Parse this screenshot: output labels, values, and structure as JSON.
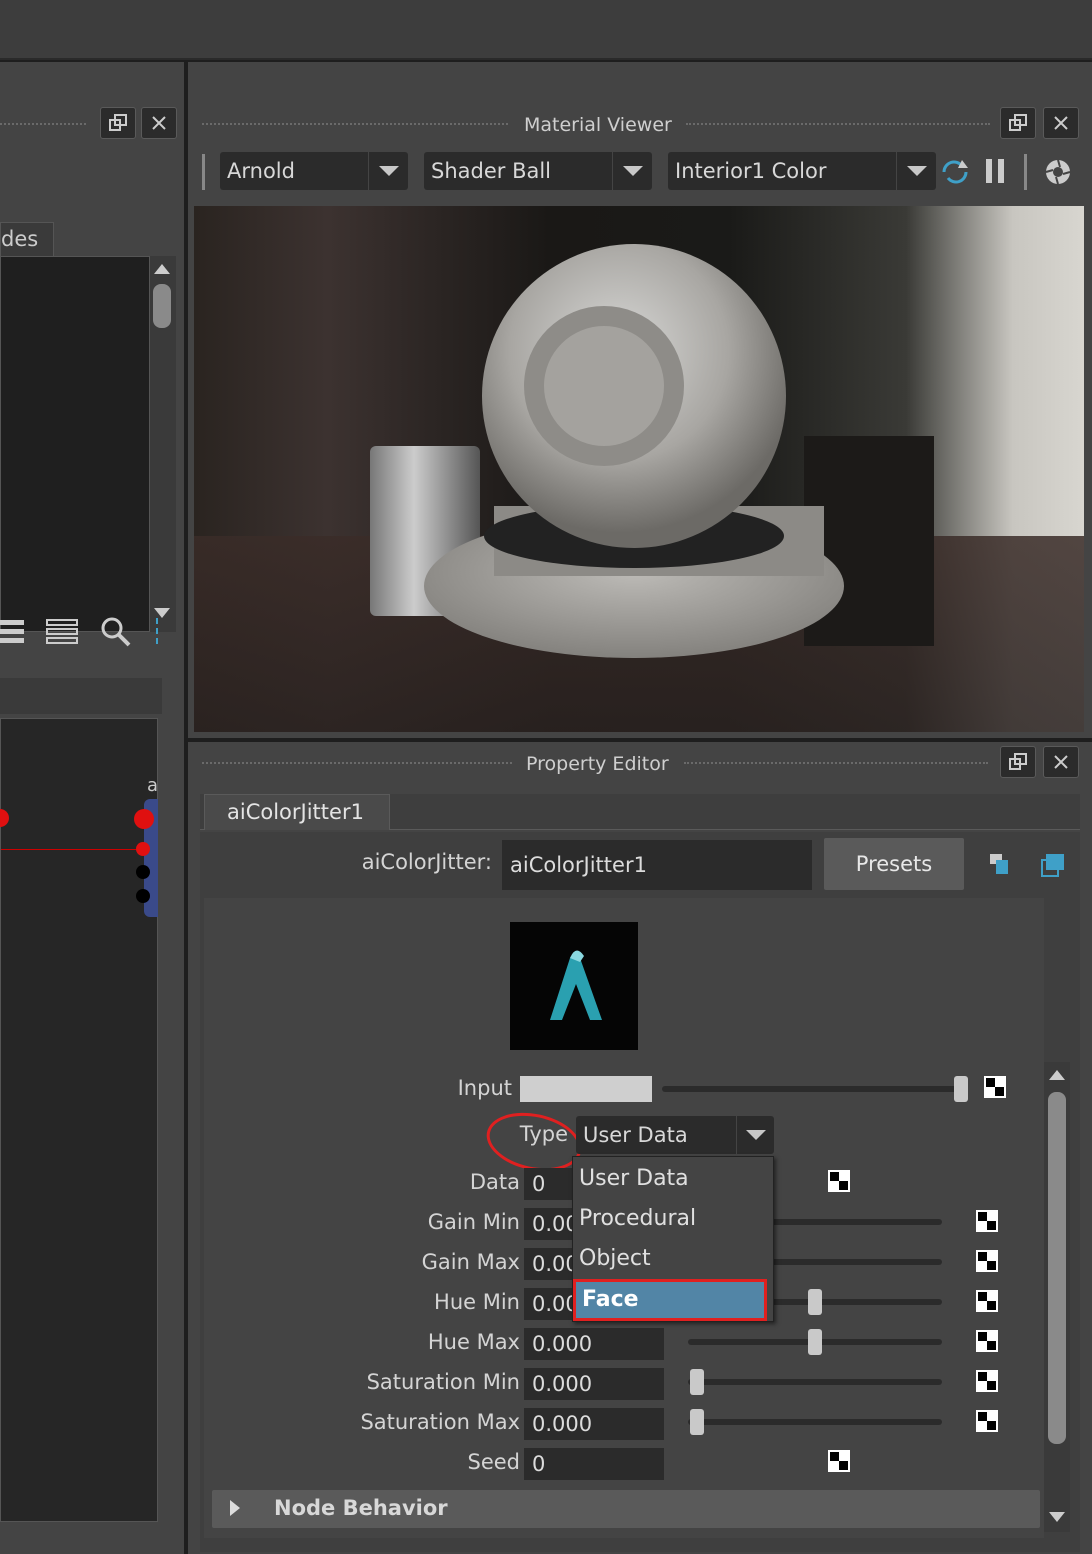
{
  "material_viewer": {
    "title": "Material Viewer",
    "renderer": "Arnold",
    "geometry": "Shader Ball",
    "environment": "Interior1 Color"
  },
  "left_panel": {
    "tab_partial": "des",
    "graph_node_label": "a"
  },
  "property_editor": {
    "title": "Property Editor",
    "tab": "aiColorJitter1",
    "node_type_label": "aiColorJitter:",
    "node_name": "aiColorJitter1",
    "presets_label": "Presets",
    "input_label": "Input",
    "type_label": "Type",
    "type_value": "User Data",
    "type_options": [
      "User Data",
      "Procedural",
      "Object",
      "Face"
    ],
    "highlighted_option": "Face",
    "rows": [
      {
        "label": "Data",
        "value": "0"
      },
      {
        "label": "Gain Min",
        "value": "0.00"
      },
      {
        "label": "Gain Max",
        "value": "0.00"
      },
      {
        "label": "Hue Min",
        "value": "0.00"
      },
      {
        "label": "Hue Max",
        "value": "0.000"
      },
      {
        "label": "Saturation Min",
        "value": "0.000"
      },
      {
        "label": "Saturation Max",
        "value": "0.000"
      },
      {
        "label": "Seed",
        "value": "0"
      }
    ],
    "section_label": "Node Behavior"
  }
}
